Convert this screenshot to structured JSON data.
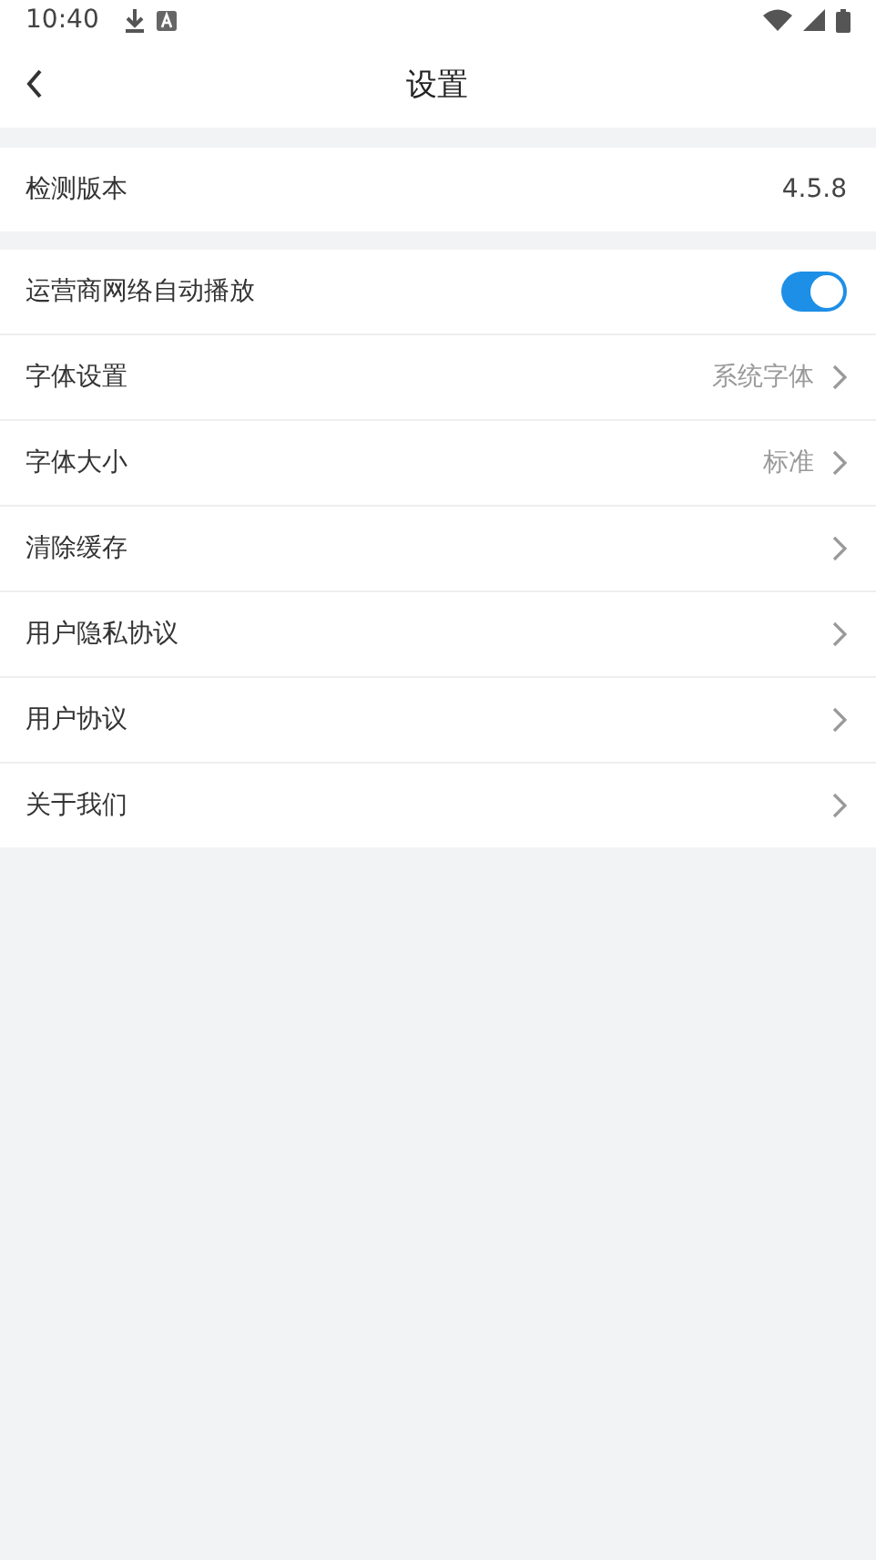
{
  "status_bar": {
    "time": "10:40"
  },
  "header": {
    "title": "设置"
  },
  "sections": [
    {
      "rows": [
        {
          "kind": "value",
          "label": "检测版本",
          "value": "4.5.8"
        }
      ]
    },
    {
      "rows": [
        {
          "kind": "toggle",
          "label": "运营商网络自动播放",
          "on": true
        },
        {
          "kind": "link",
          "label": "字体设置",
          "value": "系统字体"
        },
        {
          "kind": "link",
          "label": "字体大小",
          "value": "标准"
        },
        {
          "kind": "link",
          "label": "清除缓存"
        },
        {
          "kind": "link",
          "label": "用户隐私协议"
        },
        {
          "kind": "link",
          "label": "用户协议"
        },
        {
          "kind": "link",
          "label": "关于我们"
        }
      ]
    }
  ]
}
